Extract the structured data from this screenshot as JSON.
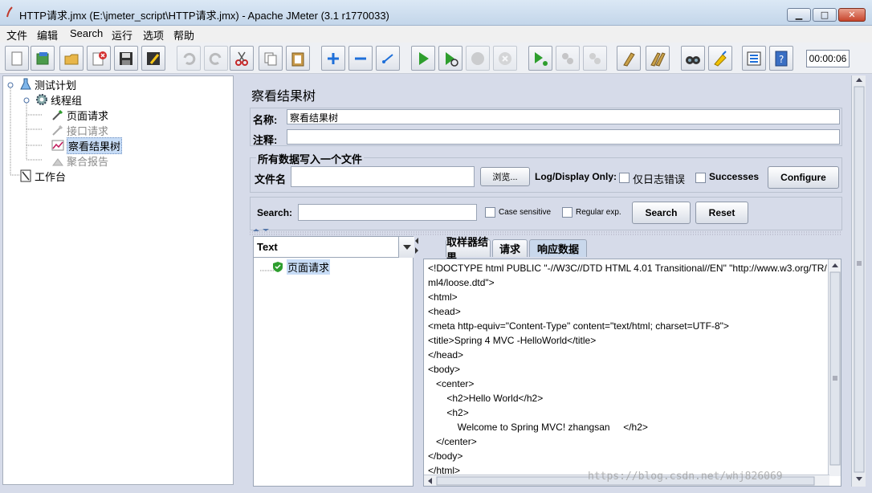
{
  "window": {
    "title": "HTTP请求.jmx (E:\\jmeter_script\\HTTP请求.jmx) - Apache JMeter (3.1 r1770033)",
    "minimize": "▁",
    "maximize": "□",
    "close": "✕"
  },
  "menu": [
    "文件",
    "编辑",
    "Search",
    "运行",
    "选项",
    "帮助"
  ],
  "toolbar": {
    "timer": "00:00:06",
    "icons": [
      "new-icon",
      "templates-icon",
      "open-icon",
      "close-icon",
      "save-icon",
      "save-as-icon",
      "undo-icon",
      "redo-icon",
      "cut-icon",
      "copy-icon",
      "paste-icon",
      "expand-icon",
      "collapse-icon",
      "toggle-icon",
      "start-icon",
      "start-no-pause-icon",
      "stop-icon",
      "shutdown-icon",
      "remote-start-icon",
      "remote-stop-icon",
      "remote-shutdown-icon",
      "clear-icon",
      "clear-all-icon",
      "search-icon",
      "reset-search-icon",
      "function-helper-icon",
      "help-icon"
    ]
  },
  "tree": {
    "items": [
      {
        "label": "测试计划",
        "icon": "flask-icon"
      },
      {
        "label": "线程组",
        "icon": "gear-icon"
      },
      {
        "label": "页面请求",
        "icon": "pipette-icon"
      },
      {
        "label": "接口请求",
        "icon": "pipette-icon"
      },
      {
        "label": "察看结果树",
        "icon": "chart-icon"
      },
      {
        "label": "聚合报告",
        "icon": "chart-icon"
      },
      {
        "label": "工作台",
        "icon": "workbench-icon"
      }
    ]
  },
  "panel": {
    "heading": "察看结果树",
    "name_label": "名称:",
    "name_value": "察看结果树",
    "comment_label": "注释:",
    "comment_value": "",
    "file_group_title": "所有数据写入一个文件",
    "filename_label": "文件名",
    "filename_value": "",
    "browse_label": "浏览...",
    "log_display_label": "Log/Display Only:",
    "errors_only_label": "仅日志错误",
    "successes_label": "Successes",
    "configure_label": "Configure",
    "search_label": "Search:",
    "search_value": "",
    "case_sensitive_label": "Case sensitive",
    "regex_label": "Regular exp.",
    "search_button": "Search",
    "reset_button": "Reset"
  },
  "results": {
    "renderer": "Text",
    "samples": [
      "页面请求"
    ],
    "tabs": [
      "取样器结果",
      "请求",
      "响应数据"
    ],
    "active_tab": "响应数据",
    "response_lines": [
      "<!DOCTYPE html PUBLIC \"-//W3C//DTD HTML 4.01 Transitional//EN\" \"http://www.w3.org/TR/",
      "ml4/loose.dtd\">",
      "<html>",
      "<head>",
      "<meta http-equiv=\"Content-Type\" content=\"text/html; charset=UTF-8\">",
      "<title>Spring 4 MVC -HelloWorld</title>",
      "</head>",
      "<body>",
      "   <center>",
      "       <h2>Hello World</h2>",
      "       <h2>",
      "           Welcome to Spring MVC! zhangsan     </h2>",
      "   </center>",
      "</body>",
      "</html>"
    ]
  },
  "watermark": "https://blog.csdn.net/whj826069"
}
